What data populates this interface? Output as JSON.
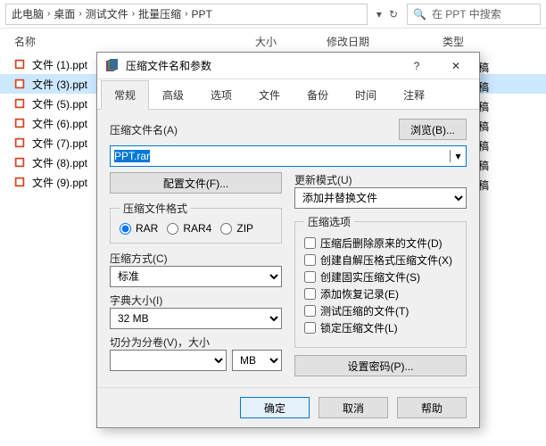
{
  "breadcrumb": [
    "此电脑",
    "桌面",
    "测试文件",
    "批量压缩",
    "PPT"
  ],
  "search_placeholder": "在 PPT 中搜索",
  "columns": {
    "name": "名称",
    "size": "大小",
    "date": "修改日期",
    "type": "类型"
  },
  "file_type_label": "演示文稿",
  "files": [
    {
      "name": "文件 (1).ppt"
    },
    {
      "name": "文件 (3).ppt",
      "selected": true
    },
    {
      "name": "文件 (5).ppt"
    },
    {
      "name": "文件 (6).ppt"
    },
    {
      "name": "文件 (7).ppt"
    },
    {
      "name": "文件 (8).ppt"
    },
    {
      "name": "文件 (9).ppt"
    }
  ],
  "dialog": {
    "title": "压缩文件名和参数",
    "tabs": [
      "常规",
      "高级",
      "选项",
      "文件",
      "备份",
      "时间",
      "注释"
    ],
    "filename_label": "压缩文件名(A)",
    "browse_btn": "浏览(B)...",
    "filename_value": "PPT.rar",
    "profiles_btn": "配置文件(F)...",
    "update_label": "更新模式(U)",
    "update_value": "添加并替换文件",
    "format_legend": "压缩文件格式",
    "formats": [
      "RAR",
      "RAR4",
      "ZIP"
    ],
    "method_label": "压缩方式(C)",
    "method_value": "标准",
    "dict_label": "字典大小(I)",
    "dict_value": "32 MB",
    "split_label": "切分为分卷(V)，大小",
    "split_unit": "MB",
    "options_legend": "压缩选项",
    "opts": [
      "压缩后删除原来的文件(D)",
      "创建自解压格式压缩文件(X)",
      "创建固实压缩文件(S)",
      "添加恢复记录(E)",
      "测试压缩的文件(T)",
      "锁定压缩文件(L)"
    ],
    "password_btn": "设置密码(P)...",
    "ok": "确定",
    "cancel": "取消",
    "help": "帮助"
  }
}
